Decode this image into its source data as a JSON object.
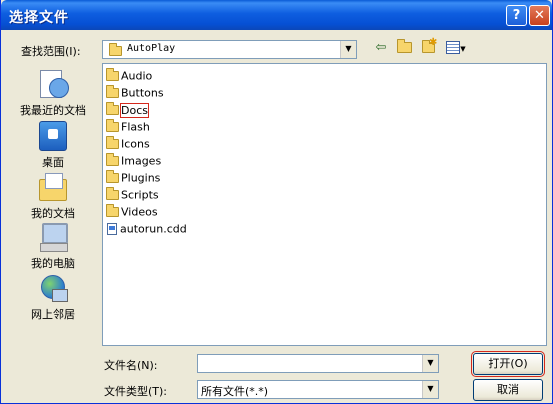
{
  "title": "选择文件",
  "title_buttons": {
    "help": "?",
    "close": "✕"
  },
  "lookin": {
    "label": "查找范围(I):",
    "value": "AutoPlay"
  },
  "toolbar": [
    "back-arrow-icon",
    "up-folder-icon",
    "new-folder-icon",
    "view-menu-icon"
  ],
  "places": [
    {
      "label": "我最近的文档",
      "icon": "recent-documents-icon"
    },
    {
      "label": "桌面",
      "icon": "desktop-icon"
    },
    {
      "label": "我的文档",
      "icon": "my-documents-icon"
    },
    {
      "label": "我的电脑",
      "icon": "my-computer-icon"
    },
    {
      "label": "网上邻居",
      "icon": "network-places-icon"
    }
  ],
  "files": [
    {
      "name": "Audio",
      "type": "folder"
    },
    {
      "name": "Buttons",
      "type": "folder"
    },
    {
      "name": "Docs",
      "type": "folder",
      "focused": true
    },
    {
      "name": "Flash",
      "type": "folder"
    },
    {
      "name": "Icons",
      "type": "folder"
    },
    {
      "name": "Images",
      "type": "folder"
    },
    {
      "name": "Plugins",
      "type": "folder"
    },
    {
      "name": "Scripts",
      "type": "folder"
    },
    {
      "name": "Videos",
      "type": "folder"
    },
    {
      "name": "autorun.cdd",
      "type": "file"
    }
  ],
  "filename": {
    "label": "文件名(N):",
    "value": ""
  },
  "filetype": {
    "label": "文件类型(T):",
    "value": "所有文件(*.*)"
  },
  "buttons": {
    "open": "打开(O)",
    "cancel": "取消"
  },
  "colors": {
    "titlebar": "#0a5bd6",
    "dialog_bg": "#ece9d8",
    "focus": "#d4281c"
  }
}
